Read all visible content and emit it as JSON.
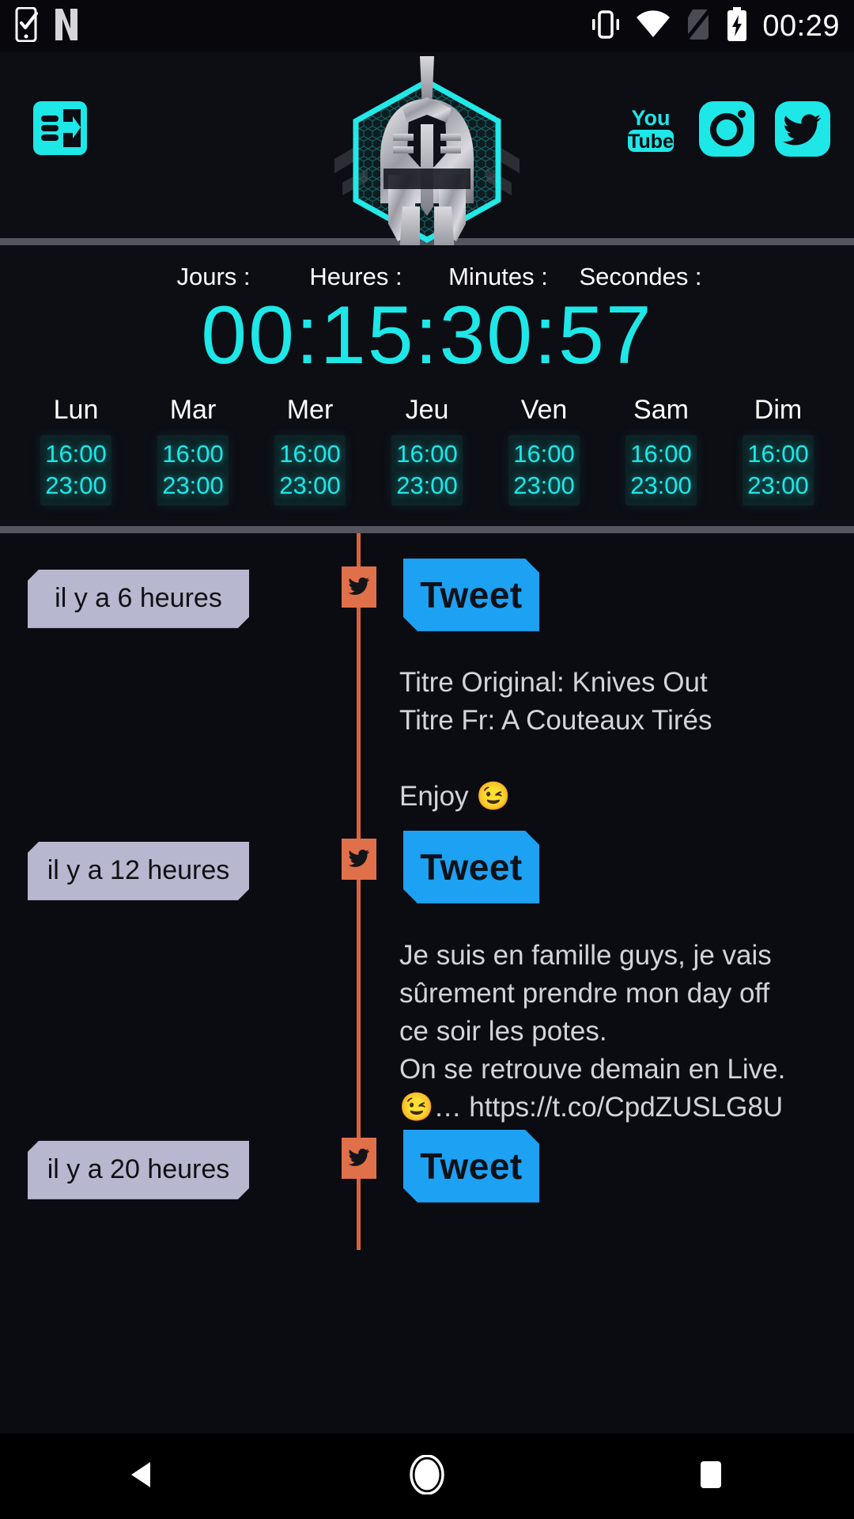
{
  "status_bar": {
    "time": "00:29",
    "icons": [
      "phone-check-icon",
      "netflix-n-icon",
      "vibrate-icon",
      "wifi-icon",
      "no-sim-icon",
      "battery-charging-icon"
    ]
  },
  "header": {
    "menu_icon": "drawer-menu-icon",
    "logo": "spartan-helmet-logo",
    "socials": [
      {
        "name": "youtube-icon",
        "label": "You Tube"
      },
      {
        "name": "instagram-icon",
        "label": "Instagram"
      },
      {
        "name": "twitter-icon",
        "label": "Twitter"
      }
    ]
  },
  "countdown": {
    "labels": [
      "Jours :",
      "Heures :",
      "Minutes :",
      "Secondes :"
    ],
    "value": "00:15:30:57",
    "days": "00",
    "hours": "15",
    "minutes": "30",
    "seconds": "57",
    "color": "#1ee7e7"
  },
  "schedule": {
    "days": [
      {
        "name": "Lun",
        "start": "16:00",
        "end": "23:00"
      },
      {
        "name": "Mar",
        "start": "16:00",
        "end": "23:00"
      },
      {
        "name": "Mer",
        "start": "16:00",
        "end": "23:00"
      },
      {
        "name": "Jeu",
        "start": "16:00",
        "end": "23:00"
      },
      {
        "name": "Ven",
        "start": "16:00",
        "end": "23:00"
      },
      {
        "name": "Sam",
        "start": "16:00",
        "end": "23:00"
      },
      {
        "name": "Dim",
        "start": "16:00",
        "end": "23:00"
      }
    ]
  },
  "feed": {
    "badge_label": "Tweet",
    "marker_icon": "twitter-bird-icon",
    "accent_line_color": "#d9633c",
    "badge_color": "#1da1f2",
    "chip_color": "#b7b8cf",
    "items": [
      {
        "time": "il y a 6 heures",
        "badge": "Tweet",
        "line1": "Titre Original: Knives Out",
        "line2": "Titre Fr: A Couteaux Tirés",
        "line3": "Enjoy 😉"
      },
      {
        "time": "il y a 12 heures",
        "badge": "Tweet",
        "line1": "Je suis en famille guys, je vais",
        "line2": "sûrement prendre mon day off",
        "line3": "ce soir les potes.",
        "line4": "On se retrouve demain en Live.",
        "line5": "😉… https://t.co/CpdZUSLG8U"
      },
      {
        "time": "il y a 20 heures",
        "badge": "Tweet"
      }
    ]
  },
  "navbar": {
    "buttons": [
      {
        "name": "back-button",
        "icon": "triangle-back-icon"
      },
      {
        "name": "home-button",
        "icon": "circle-home-icon"
      },
      {
        "name": "recents-button",
        "icon": "square-recents-icon"
      }
    ]
  }
}
